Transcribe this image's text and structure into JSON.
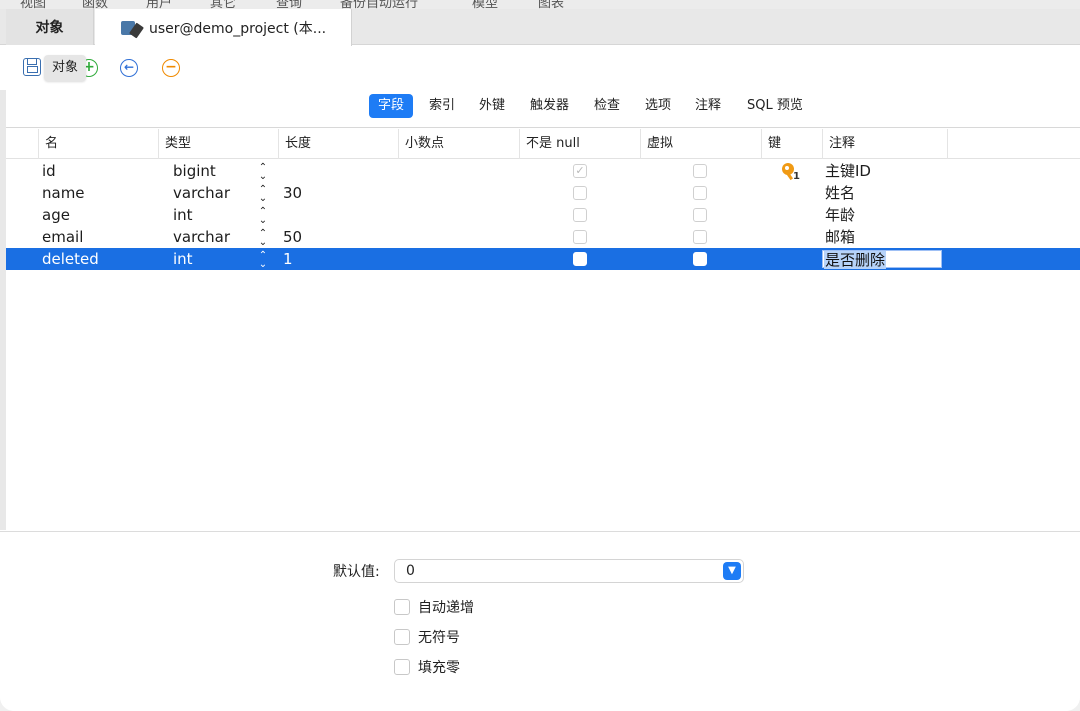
{
  "menu": [
    "视图",
    "函数",
    "用户",
    "其它",
    "查询",
    "备份",
    "自动运行",
    "模型",
    "图表"
  ],
  "tabs": {
    "objects": "对象",
    "design": "user@demo_project (本..."
  },
  "toolbar": {
    "tooltip": "对象",
    "add": "+",
    "back": "←",
    "remove": "−"
  },
  "subtabs": [
    "字段",
    "索引",
    "外键",
    "触发器",
    "检查",
    "选项",
    "注释",
    "SQL 预览"
  ],
  "grid": {
    "headers": [
      "名",
      "类型",
      "长度",
      "小数点",
      "不是 null",
      "虚拟",
      "键",
      "注释"
    ],
    "rows": [
      {
        "name": "id",
        "type": "bigint",
        "length": "",
        "not_null": true,
        "virtual": false,
        "key": true,
        "comment": "主键ID"
      },
      {
        "name": "name",
        "type": "varchar",
        "length": "30",
        "not_null": false,
        "virtual": false,
        "key": false,
        "comment": "姓名"
      },
      {
        "name": "age",
        "type": "int",
        "length": "",
        "not_null": false,
        "virtual": false,
        "key": false,
        "comment": "年龄"
      },
      {
        "name": "email",
        "type": "varchar",
        "length": "50",
        "not_null": false,
        "virtual": false,
        "key": false,
        "comment": "邮箱"
      },
      {
        "name": "deleted",
        "type": "int",
        "length": "1",
        "not_null": false,
        "virtual": false,
        "key": false,
        "comment": "是否删除"
      }
    ],
    "updown_glyph": "⌃⌄"
  },
  "bottom": {
    "default_label": "默认值:",
    "default_value": "0",
    "options": [
      "自动递增",
      "无符号",
      "填充零"
    ]
  },
  "colors": {
    "accent": "#1e7cf5",
    "selection": "#1a6fe3",
    "key": "#f09a14"
  }
}
